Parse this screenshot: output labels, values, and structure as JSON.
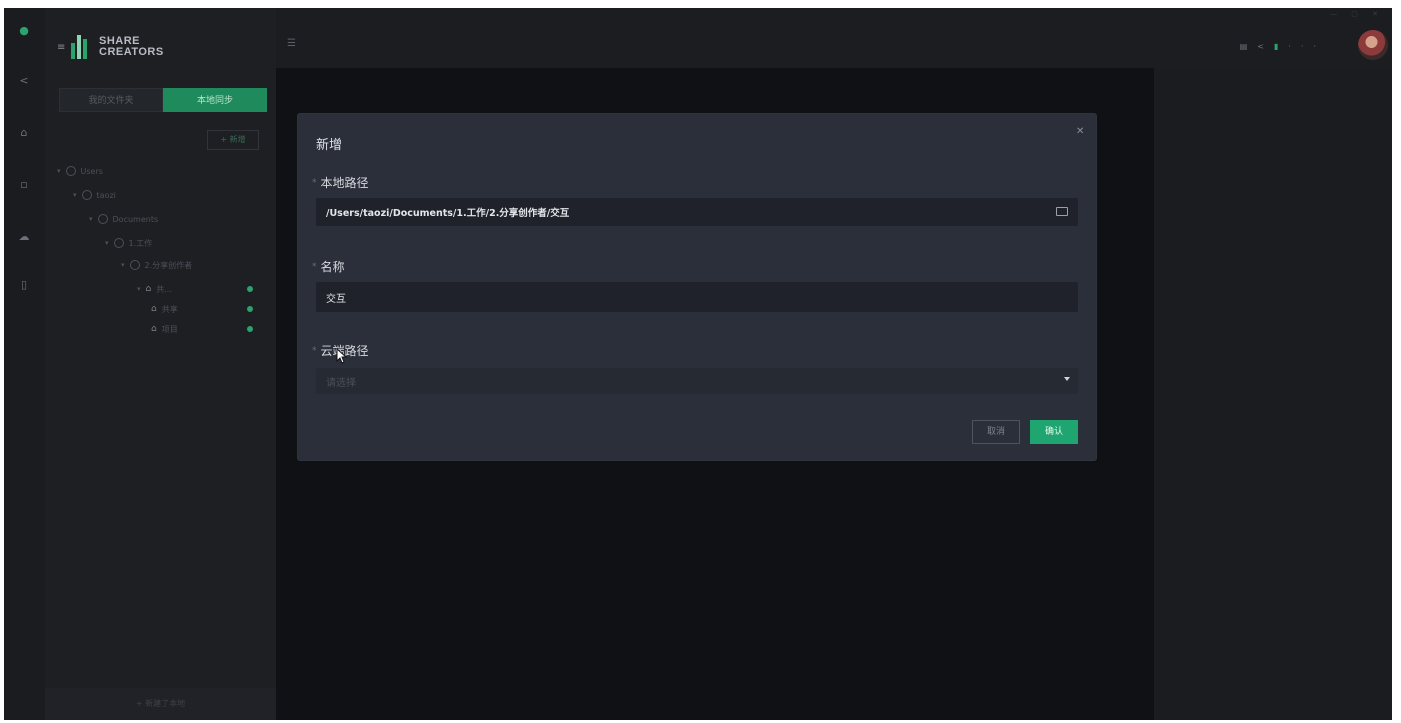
{
  "brand": {
    "line1": "SHARE",
    "line2": "CREATORS"
  },
  "panel": {
    "tabs": [
      {
        "label": "我的文件夹",
        "active": false
      },
      {
        "label": "本地同步",
        "active": true
      }
    ],
    "new_button": "+ 新增",
    "tree": [
      {
        "label": "Users",
        "kind": "folder"
      },
      {
        "label": "taozi",
        "kind": "folder"
      },
      {
        "label": "Documents",
        "kind": "folder"
      },
      {
        "label": "1.工作",
        "kind": "folder"
      },
      {
        "label": "2.分享创作者",
        "kind": "folder"
      },
      {
        "label": "共...",
        "kind": "sync"
      },
      {
        "label": "共享",
        "kind": "sync"
      },
      {
        "label": "项目",
        "kind": "sync"
      }
    ],
    "footer": "+ 新建了本地"
  },
  "modal": {
    "title": "新增",
    "close_icon": "close-icon",
    "local_path": {
      "label": "本地路径",
      "value": "/Users/taozi/Documents/1.工作/2.分享创作者/交互",
      "icon": "folder-icon"
    },
    "name": {
      "label": "名称",
      "value": "交互"
    },
    "cloud_path": {
      "label": "云端路径",
      "placeholder": "请选择",
      "icon": "chevron-down-icon"
    },
    "cancel_label": "取消",
    "confirm_label": "确认"
  },
  "colors": {
    "accent": "#1fa56f",
    "modal_bg": "#2b2f3a",
    "field_bg": "#1f222a",
    "app_bg": "#17191d"
  }
}
